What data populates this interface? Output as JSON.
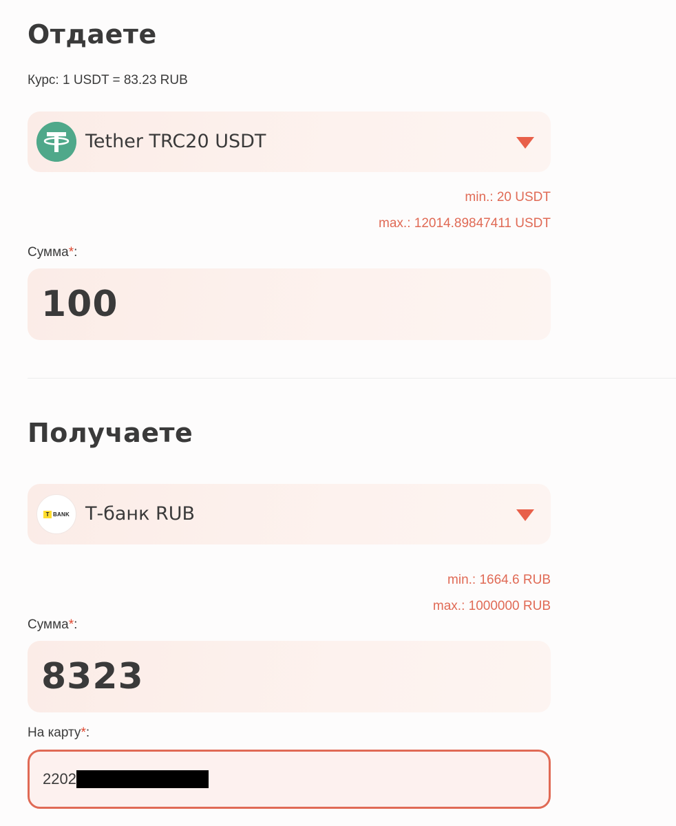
{
  "give": {
    "title": "Отдаете",
    "rate": "Курс: 1 USDT = 83.23 RUB",
    "currency": {
      "label": "Tether TRC20 USDT",
      "icon": "tether-logo-icon",
      "icon_color": "#4fa88a"
    },
    "min": "min.: 20 USDT",
    "max": "max.: 12014.89847411 USDT",
    "amount_label": "Сумма",
    "required_mark": "*",
    "label_suffix": ":",
    "amount": "100"
  },
  "receive": {
    "title": "Получаете",
    "currency": {
      "label": "Т-банк RUB",
      "icon": "tbank-logo-icon",
      "logo_letter": "T",
      "logo_text": "BANK",
      "logo_color": "#ffdd2d"
    },
    "min": "min.: 1664.6 RUB",
    "max": "max.: 1000000 RUB",
    "amount_label": "Сумма",
    "required_mark": "*",
    "label_suffix": ":",
    "amount": "8323",
    "card_label": "На карту",
    "card_value": "2202"
  },
  "colors": {
    "accent": "#e8604a",
    "limit_text": "#e06a55",
    "field_bg": "#fbece7"
  }
}
